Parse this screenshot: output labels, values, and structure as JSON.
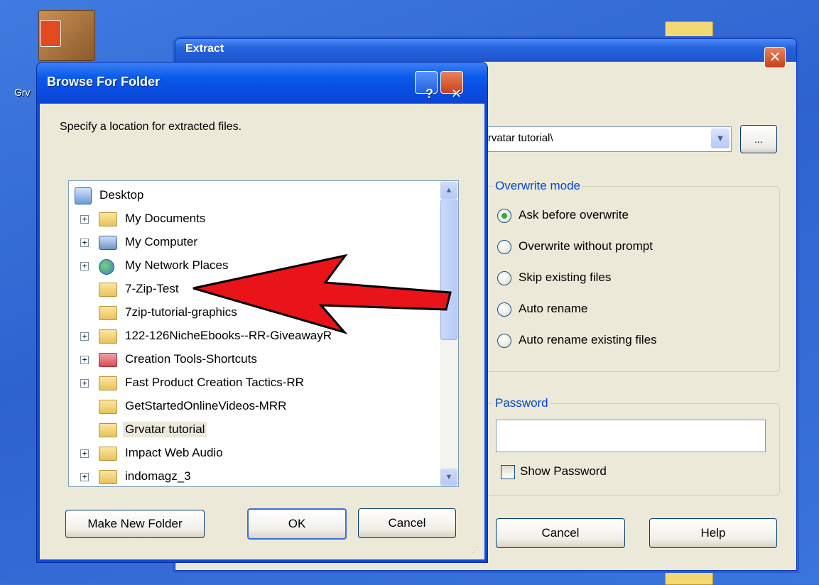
{
  "desktop": {
    "icon_label": "Grv"
  },
  "extract_dialog": {
    "title": "Extract",
    "close_glyph": "✕",
    "path_value": "\\Grvatar tutorial\\",
    "browse_button_label": "...",
    "overwrite_mode": {
      "legend": "Overwrite mode",
      "options": [
        {
          "label": "Ask before overwrite",
          "selected": true
        },
        {
          "label": "Overwrite without prompt",
          "selected": false
        },
        {
          "label": "Skip existing files",
          "selected": false
        },
        {
          "label": "Auto rename",
          "selected": false
        },
        {
          "label": "Auto rename existing files",
          "selected": false
        }
      ]
    },
    "password": {
      "legend": "Password",
      "value": "",
      "show_password_label": "Show Password",
      "show_password_checked": false
    },
    "cancel_label": "Cancel",
    "help_label": "Help"
  },
  "browse_dialog": {
    "title": "Browse For Folder",
    "help_glyph": "?",
    "close_glyph": "✕",
    "instruction": "Specify a location for extracted files.",
    "tree": [
      {
        "label": "Desktop",
        "icon": "desktop-icon",
        "expander": ""
      },
      {
        "label": "My Documents",
        "icon": "my-documents-icon",
        "expander": "+"
      },
      {
        "label": "My Computer",
        "icon": "my-computer-icon",
        "expander": "+"
      },
      {
        "label": "My Network Places",
        "icon": "network-places-icon",
        "expander": "+"
      },
      {
        "label": "7-Zip-Test",
        "icon": "folder-icon",
        "expander": ""
      },
      {
        "label": "7zip-tutorial-graphics",
        "icon": "folder-icon",
        "expander": ""
      },
      {
        "label": "122-126NicheEbooks--RR-GiveawayR",
        "icon": "folder-icon",
        "expander": "+"
      },
      {
        "label": "Creation Tools-Shortcuts",
        "icon": "folder-red-icon",
        "expander": "+"
      },
      {
        "label": "Fast Product Creation Tactics-RR",
        "icon": "folder-icon",
        "expander": "+"
      },
      {
        "label": "GetStartedOnlineVideos-MRR",
        "icon": "folder-icon",
        "expander": ""
      },
      {
        "label": "Grvatar tutorial",
        "icon": "folder-icon",
        "expander": "",
        "selected": true
      },
      {
        "label": "Impact Web Audio",
        "icon": "folder-icon",
        "expander": "+"
      },
      {
        "label": "indomagz_3",
        "icon": "folder-icon",
        "expander": "+"
      }
    ],
    "make_new_folder_label": "Make New Folder",
    "ok_label": "OK",
    "cancel_label": "Cancel"
  },
  "annotation": {
    "arrow_color": "#e8141a"
  }
}
